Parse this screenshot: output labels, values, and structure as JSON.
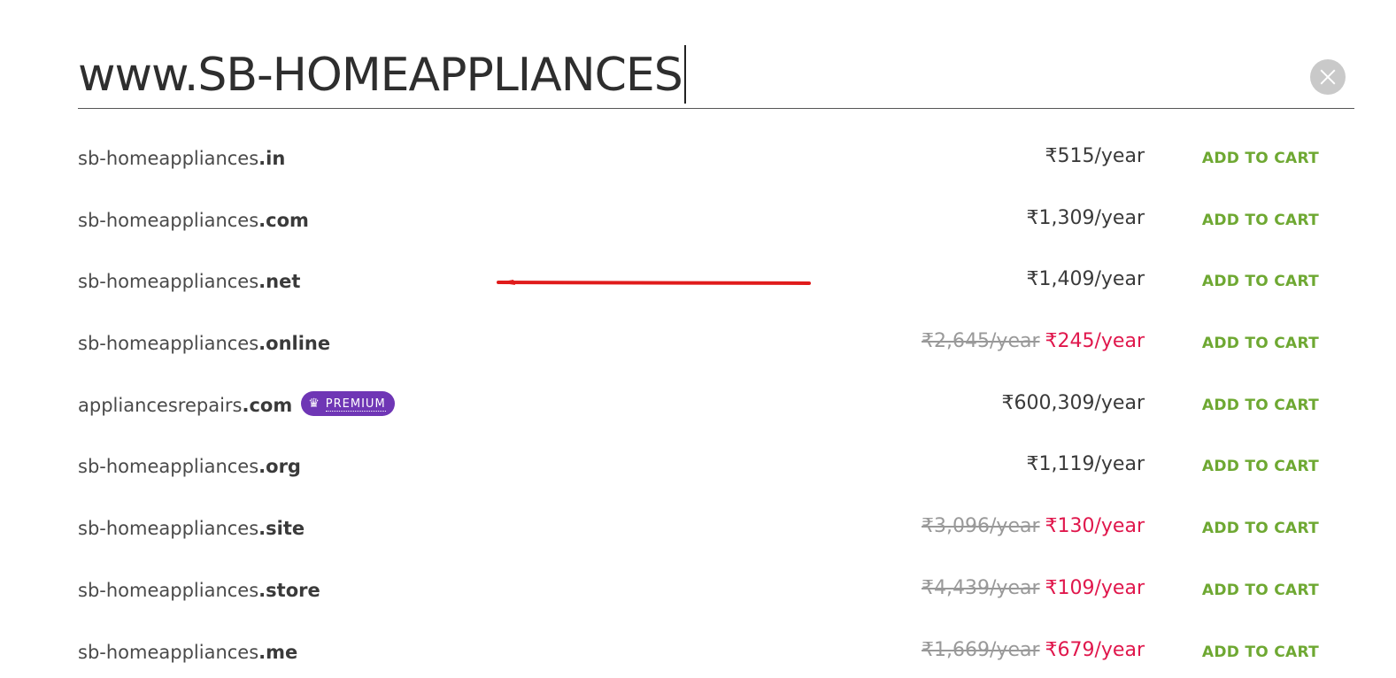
{
  "search": {
    "prefix": "www.",
    "value": "SB-HOMEAPPLIANCES"
  },
  "results": [
    {
      "name": "sb-homeappliances",
      "tld": ".in",
      "price": "₹515/year",
      "old_price": "",
      "sale_price": "",
      "premium": false,
      "cta": "ADD TO CART"
    },
    {
      "name": "sb-homeappliances",
      "tld": ".com",
      "price": "₹1,309/year",
      "old_price": "",
      "sale_price": "",
      "premium": false,
      "cta": "ADD TO CART"
    },
    {
      "name": "sb-homeappliances",
      "tld": ".net",
      "price": "₹1,409/year",
      "old_price": "",
      "sale_price": "",
      "premium": false,
      "cta": "ADD TO CART"
    },
    {
      "name": "sb-homeappliances",
      "tld": ".online",
      "price": "",
      "old_price": "₹2,645/year",
      "sale_price": "₹245/year",
      "premium": false,
      "cta": "ADD TO CART"
    },
    {
      "name": "appliancesrepairs",
      "tld": ".com",
      "price": "₹600,309/year",
      "old_price": "",
      "sale_price": "",
      "premium": true,
      "badge": "PREMIUM",
      "cta": "ADD TO CART"
    },
    {
      "name": "sb-homeappliances",
      "tld": ".org",
      "price": "₹1,119/year",
      "old_price": "",
      "sale_price": "",
      "premium": false,
      "cta": "ADD TO CART"
    },
    {
      "name": "sb-homeappliances",
      "tld": ".site",
      "price": "",
      "old_price": "₹3,096/year",
      "sale_price": "₹130/year",
      "premium": false,
      "cta": "ADD TO CART"
    },
    {
      "name": "sb-homeappliances",
      "tld": ".store",
      "price": "",
      "old_price": "₹4,439/year",
      "sale_price": "₹109/year",
      "premium": false,
      "cta": "ADD TO CART"
    },
    {
      "name": "sb-homeappliances",
      "tld": ".me",
      "price": "",
      "old_price": "₹1,669/year",
      "sale_price": "₹679/year",
      "premium": false,
      "cta": "ADD TO CART"
    }
  ],
  "colors": {
    "cta": "#6ea832",
    "sale": "#e0174c",
    "strikethrough": "#999999",
    "premium_badge": "#6f36b5",
    "annotation": "#e01b1b"
  },
  "icons": {
    "clear": "close-icon",
    "premium": "crown-icon"
  }
}
